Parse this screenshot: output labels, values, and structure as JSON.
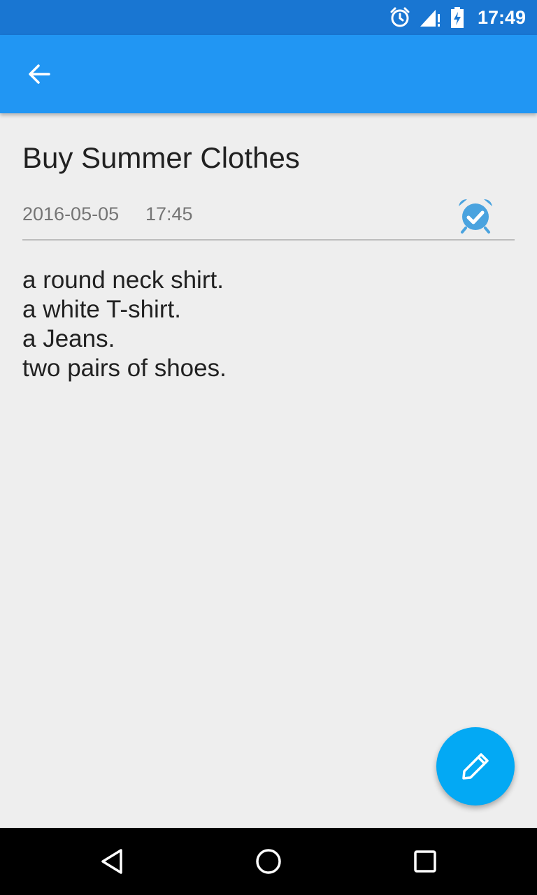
{
  "status_bar": {
    "time": "17:49",
    "icons": [
      "alarm-icon",
      "signal-icon",
      "battery-icon"
    ]
  },
  "app_bar": {
    "back_icon": "arrow-back-icon"
  },
  "note": {
    "title": "Buy Summer Clothes",
    "date": "2016-05-05",
    "time": "17:45",
    "alarm_icon": "alarm-check-icon",
    "lines": [
      "a round neck shirt.",
      "a white T-shirt.",
      "a Jeans.",
      "two pairs of shoes."
    ]
  },
  "fab": {
    "icon": "edit-pencil-icon"
  },
  "nav_bar": {
    "icons": [
      "back-triangle-icon",
      "home-circle-icon",
      "recents-square-icon"
    ]
  },
  "colors": {
    "status_bar": "#1976d2",
    "app_bar": "#2196f3",
    "fab": "#03a9f4",
    "background": "#eeeeee",
    "alarm_icon": "#4aa3df"
  }
}
